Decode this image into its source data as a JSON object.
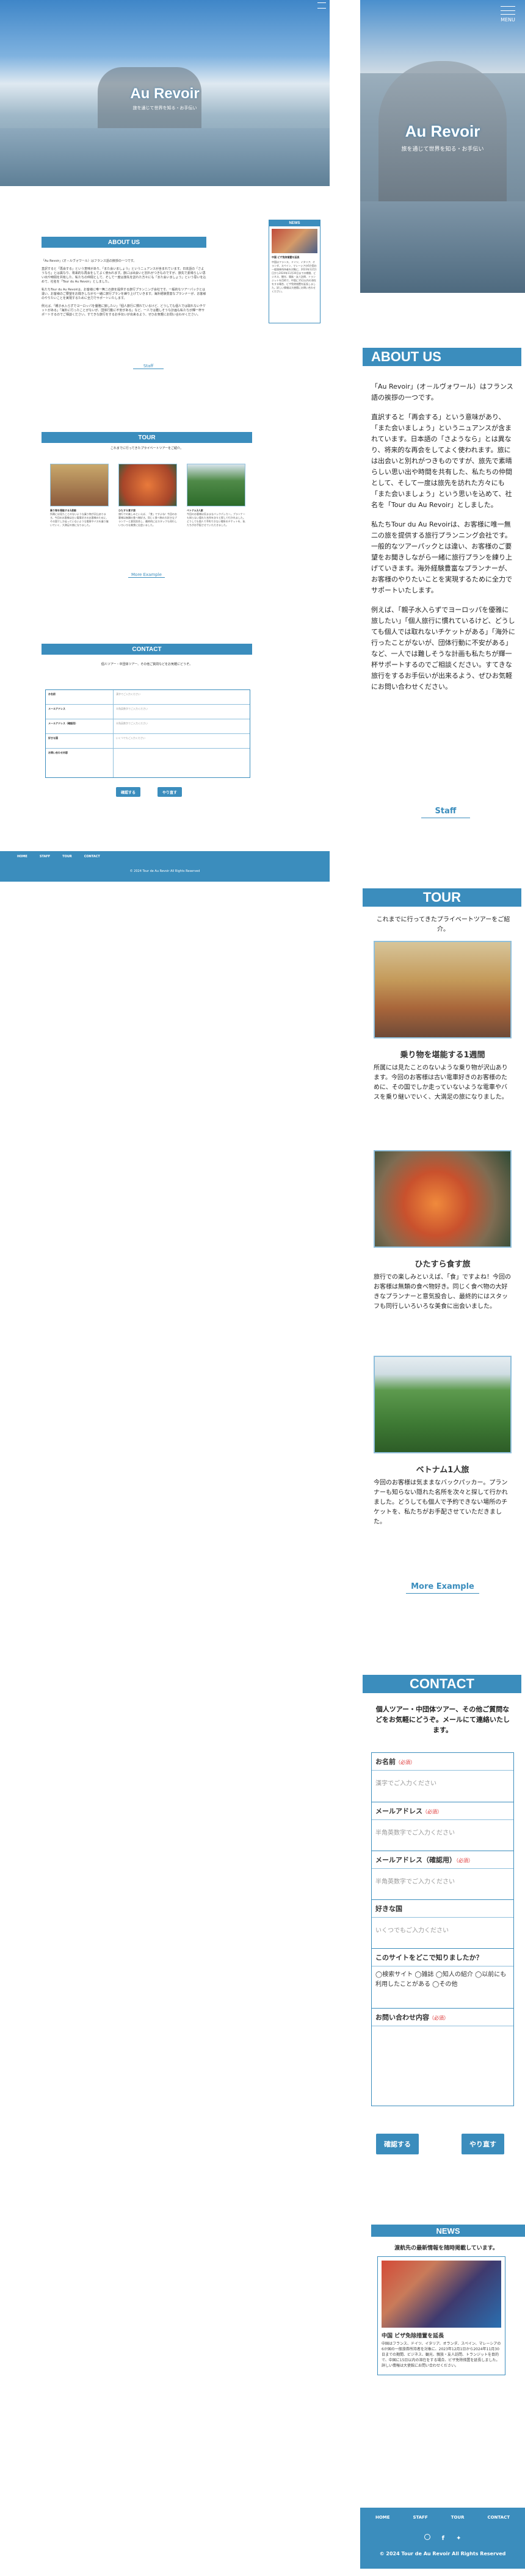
{
  "brand": {
    "name": "Au Revoir",
    "tagline": "旅を通じて世界を知る・お手伝い",
    "accent": "#3b8dbd",
    "footer_copy": "© 2024 Tour de Au Revoir All Rights Reserved"
  },
  "header": {
    "menu_label": "MENU"
  },
  "sections": {
    "about_title": "ABOUT US",
    "tour_title": "TOUR",
    "contact_title": "CONTACT",
    "news_title": "NEWS"
  },
  "about": {
    "p1": "「Au Revoir」(オ－ルヴォワール）はフランス語の挨拶の一つです。",
    "p2": "直訳すると「再会する」という意味があり、「また会いましょう」というニュアンスが含まれています。日本語の「さようなら」とは異なり、将来的な再会をしてよく使われます。旅には出会いと別れがつきものですが、旅先で素晴らしい思い出や時間を共有した、私たちの仲間として、そして一度は旅先を訪れた方々にも「また会いましょう」という思いを込めて、社名を「Tour du Au Revoir」としました。",
    "p3": "私たちTour du Au Revoirは、お客様に唯一無二の旅を提供する旅行プランニング会社です。一般的なツアーパックとは違い、お客様のご要望をお聞きしながら一緒に旅行プランを練り上げていきます。海外経験豊富なプランナーが、お客様のやりたいことを実現するために全力でサポートいたします。",
    "p4": "例えば、「親子水入らずでヨーロッパを優雅に旅したい」「個人旅行に慣れているけど、どうしても個人では取れないチケットがある」「海外に行ったことがないが、団体行動に不安がある」など、一人では難しそうな計画も私たちが輝一杯サポートするのでご相談ください。すてきな旅行をするお手伝いが出来るよう、ぜひお気軽にお問い合わせください。",
    "staff_label": "Staff"
  },
  "tour": {
    "intro": "これまでに行ってきたプライベートツアーをご紹介。",
    "items": [
      {
        "title": "乗り物を堪能する1週間",
        "text": "所属には見たことのないような乗り物が沢山あります。今回のお客様は古い電車好きのお客様のために、その国でしか走っていないような電車やバスを乗り継いでいく、大満足の旅になりました。"
      },
      {
        "title": "ひたすら食す旅",
        "text": "旅行での楽しみといえば、「食」ですよね！今回のお客様は無類の食べ物好き。同じく食べ物の大好きなプランナーと意気投合し、最終的にはスタッフも同行しいろいろな美食に出会いました。"
      },
      {
        "title": "ベトナム1人旅",
        "text": "今回のお客様は気ままなバックパッカー。プランナーも知らない隠れた名所を次々と探して行かれました。どうしても個人で予約できない場所のチケットを、私たちがお手配させていただきました。"
      }
    ],
    "more_label": "More Example"
  },
  "contact": {
    "intro": "個人ツアー・中団体ツアー、その他ご質問などをお気軽にどうぞ。メールにて連絡いたします。",
    "required_tag": "（必須）",
    "fields": [
      {
        "label": "お名前",
        "required": true,
        "placeholder": "漢字でご入力ください"
      },
      {
        "label": "メールアドレス",
        "required": true,
        "placeholder": "半角英数字でご入力ください"
      },
      {
        "label": "メールアドレス（確認用）",
        "required": true,
        "placeholder": "半角英数字でご入力ください"
      },
      {
        "label": "好きな国",
        "required": false,
        "placeholder": "いくつでもご入力ください"
      }
    ],
    "source_label": "このサイトをどこで知りましたか？",
    "source_options": "◯検索サイト ◯雑誌 ◯知人の紹介 ◯以前にも利用したことがある ◯その他",
    "message_label": "お問い合わせ内容",
    "submit_label": "確認する",
    "reset_label": "やり直す"
  },
  "news": {
    "intro": "渡航先の最新情報を随時掲載しています。",
    "item_title": "中国 ビザ免除措置を延長",
    "item_text": "中国はフランス、ドイツ、イタリア、オランダ、スペイン、マレーシアの6か国の一般旅券所持者を対象に、2023年12月1日から2024年11月30日までの期間、ビジネス、観光、親族・友人訪問、トランジットを目的で、中国に15日以内の滞在をする場合、ビザ免除措置を延長しました。詳しい情報は大使館にお問い合わせください。"
  },
  "footer": {
    "links": [
      "HOME",
      "STAFF",
      "TOUR",
      "CONTACT"
    ]
  },
  "desktop_preview": {
    "about_title": "ABOUT US",
    "tour_title": "TOUR",
    "contact_title": "CONTACT",
    "news_title": "NEWS",
    "tour_intro": "これまでに行ってきたプライベートツアーをご紹介。",
    "tour_items": [
      "乗り物を堪能する1週間",
      "ひたすら食す旅",
      "ベトナム1人旅"
    ],
    "contact_intro": "個人ツアー・中団体ツアー、その他ご質問などをお気軽にどうぞ。",
    "submit": "確認する",
    "reset": "やり直す",
    "more": "More Example",
    "staff": "Staff"
  }
}
